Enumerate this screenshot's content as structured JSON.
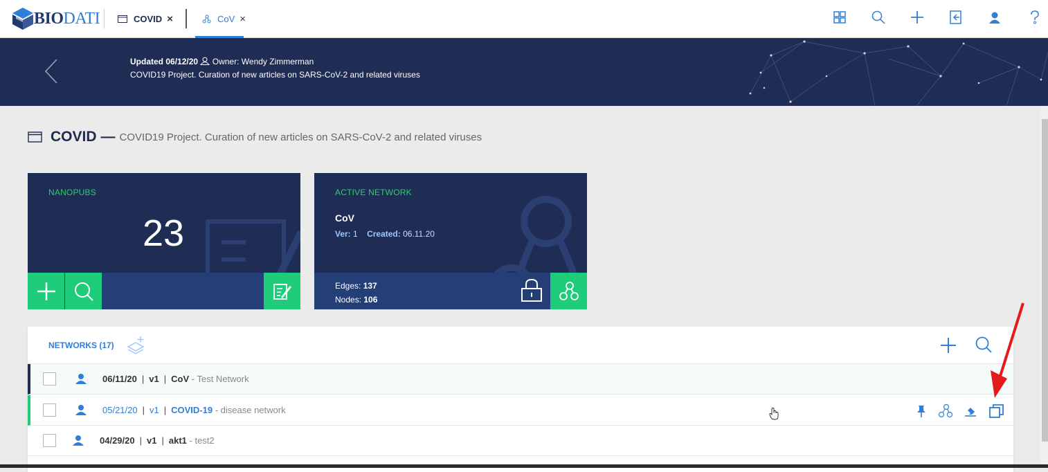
{
  "app": {
    "logo_bio": "BIO",
    "logo_dati": "DATI"
  },
  "tabs": [
    {
      "label": "COVID",
      "close": "×"
    },
    {
      "label": "CoV",
      "close": "×"
    }
  ],
  "toolbar_icons": [
    "grid-icon",
    "search-icon",
    "plus-icon",
    "exit-icon",
    "user-icon",
    "help-icon"
  ],
  "banner": {
    "updated_label": "Updated",
    "updated_date": "06/12/20",
    "owner_label": "Owner:",
    "owner_name": "Wendy Zimmerman",
    "description": "COVID19 Project. Curation of new articles on SARS-CoV-2 and related viruses"
  },
  "project": {
    "name": "COVID",
    "dash": "—",
    "description": "COVID19 Project. Curation of new articles on SARS-CoV-2 and related viruses"
  },
  "nanopubs_card": {
    "label": "NANOPUBS",
    "count": "23"
  },
  "active_network_card": {
    "label": "ACTIVE NETWORK",
    "name": "CoV",
    "ver_label": "Ver:",
    "ver_value": "1",
    "created_label": "Created:",
    "created_value": "06.11.20",
    "edges_label": "Edges:",
    "edges_value": "137",
    "nodes_label": "Nodes:",
    "nodes_value": "106"
  },
  "networks_panel": {
    "title": "NETWORKS (17)",
    "rows": [
      {
        "date": "06/11/20",
        "ver": "v1",
        "name": "CoV",
        "desc": "- Test Network",
        "sep": "|"
      },
      {
        "date": "05/21/20",
        "ver": "v1",
        "name": "COVID-19",
        "desc": "- disease network",
        "sep": "|"
      },
      {
        "date": "04/29/20",
        "ver": "v1",
        "name": "akt1",
        "desc": "- test2",
        "sep": "|"
      }
    ],
    "row_action_icons": [
      "pin-icon",
      "network-icon",
      "eraser-icon",
      "copy-icon"
    ]
  },
  "colors": {
    "navy": "#1f2d55",
    "accent_blue": "#2f7ed8",
    "green": "#1fcc7a",
    "annotation_arrow": "#e31b1b"
  }
}
